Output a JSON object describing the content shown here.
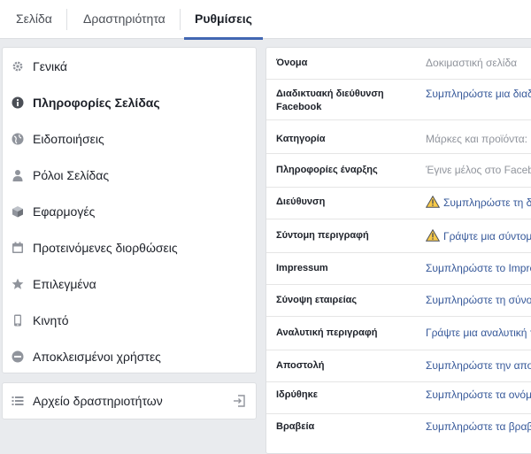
{
  "tabs": {
    "page": "Σελίδα",
    "activity": "Δραστηριότητα",
    "settings": "Ρυθμίσεις"
  },
  "menu": {
    "items": [
      {
        "label": "Γενικά",
        "icon": "gear-icon"
      },
      {
        "label": "Πληροφορίες Σελίδας",
        "icon": "info-icon"
      },
      {
        "label": "Ειδοποιήσεις",
        "icon": "globe-icon"
      },
      {
        "label": "Ρόλοι Σελίδας",
        "icon": "person-icon"
      },
      {
        "label": "Εφαρμογές",
        "icon": "cube-icon"
      },
      {
        "label": "Προτεινόμενες διορθώσεις",
        "icon": "calendar-icon"
      },
      {
        "label": "Επιλεγμένα",
        "icon": "star-icon"
      },
      {
        "label": "Κινητό",
        "icon": "mobile-icon"
      },
      {
        "label": "Αποκλεισμένοι χρήστες",
        "icon": "blocked-icon"
      }
    ],
    "activity_log": "Αρχείο δραστηριοτήτων"
  },
  "info": {
    "rows": [
      {
        "label": "Όνομα",
        "value": "Δοκιμαστική σελίδα"
      },
      {
        "label": "Διαδικτυακή διεύθυνση Facebook",
        "value": "Συμπληρώστε μια διαδικτυακή διεύθυνση"
      },
      {
        "label": "Κατηγορία",
        "value": "Μάρκες και προϊόντα: Ηλεκτρονικά"
      },
      {
        "label": "Πληροφορίες έναρξης",
        "value": "Έγινε μέλος στο Facebook"
      },
      {
        "label": "Διεύθυνση",
        "value": "Συμπληρώστε τη διεύθυνση"
      },
      {
        "label": "Σύντομη περιγραφή",
        "value": "Γράψτε μια σύντομη περιγραφή"
      },
      {
        "label": "Impressum",
        "value": "Συμπληρώστε το Impressum"
      },
      {
        "label": "Σύνοψη εταιρείας",
        "value": "Συμπληρώστε τη σύνοψη"
      },
      {
        "label": "Αναλυτική περιγραφή",
        "value": "Γράψτε μια αναλυτική περιγραφή"
      },
      {
        "label": "Αποστολή",
        "value": "Συμπληρώστε την αποστολή"
      },
      {
        "label": "Ιδρύθηκε",
        "value": "Συμπληρώστε τα ονόματα"
      },
      {
        "label": "Βραβεία",
        "value": "Συμπληρώστε τα βραβεία"
      }
    ]
  }
}
